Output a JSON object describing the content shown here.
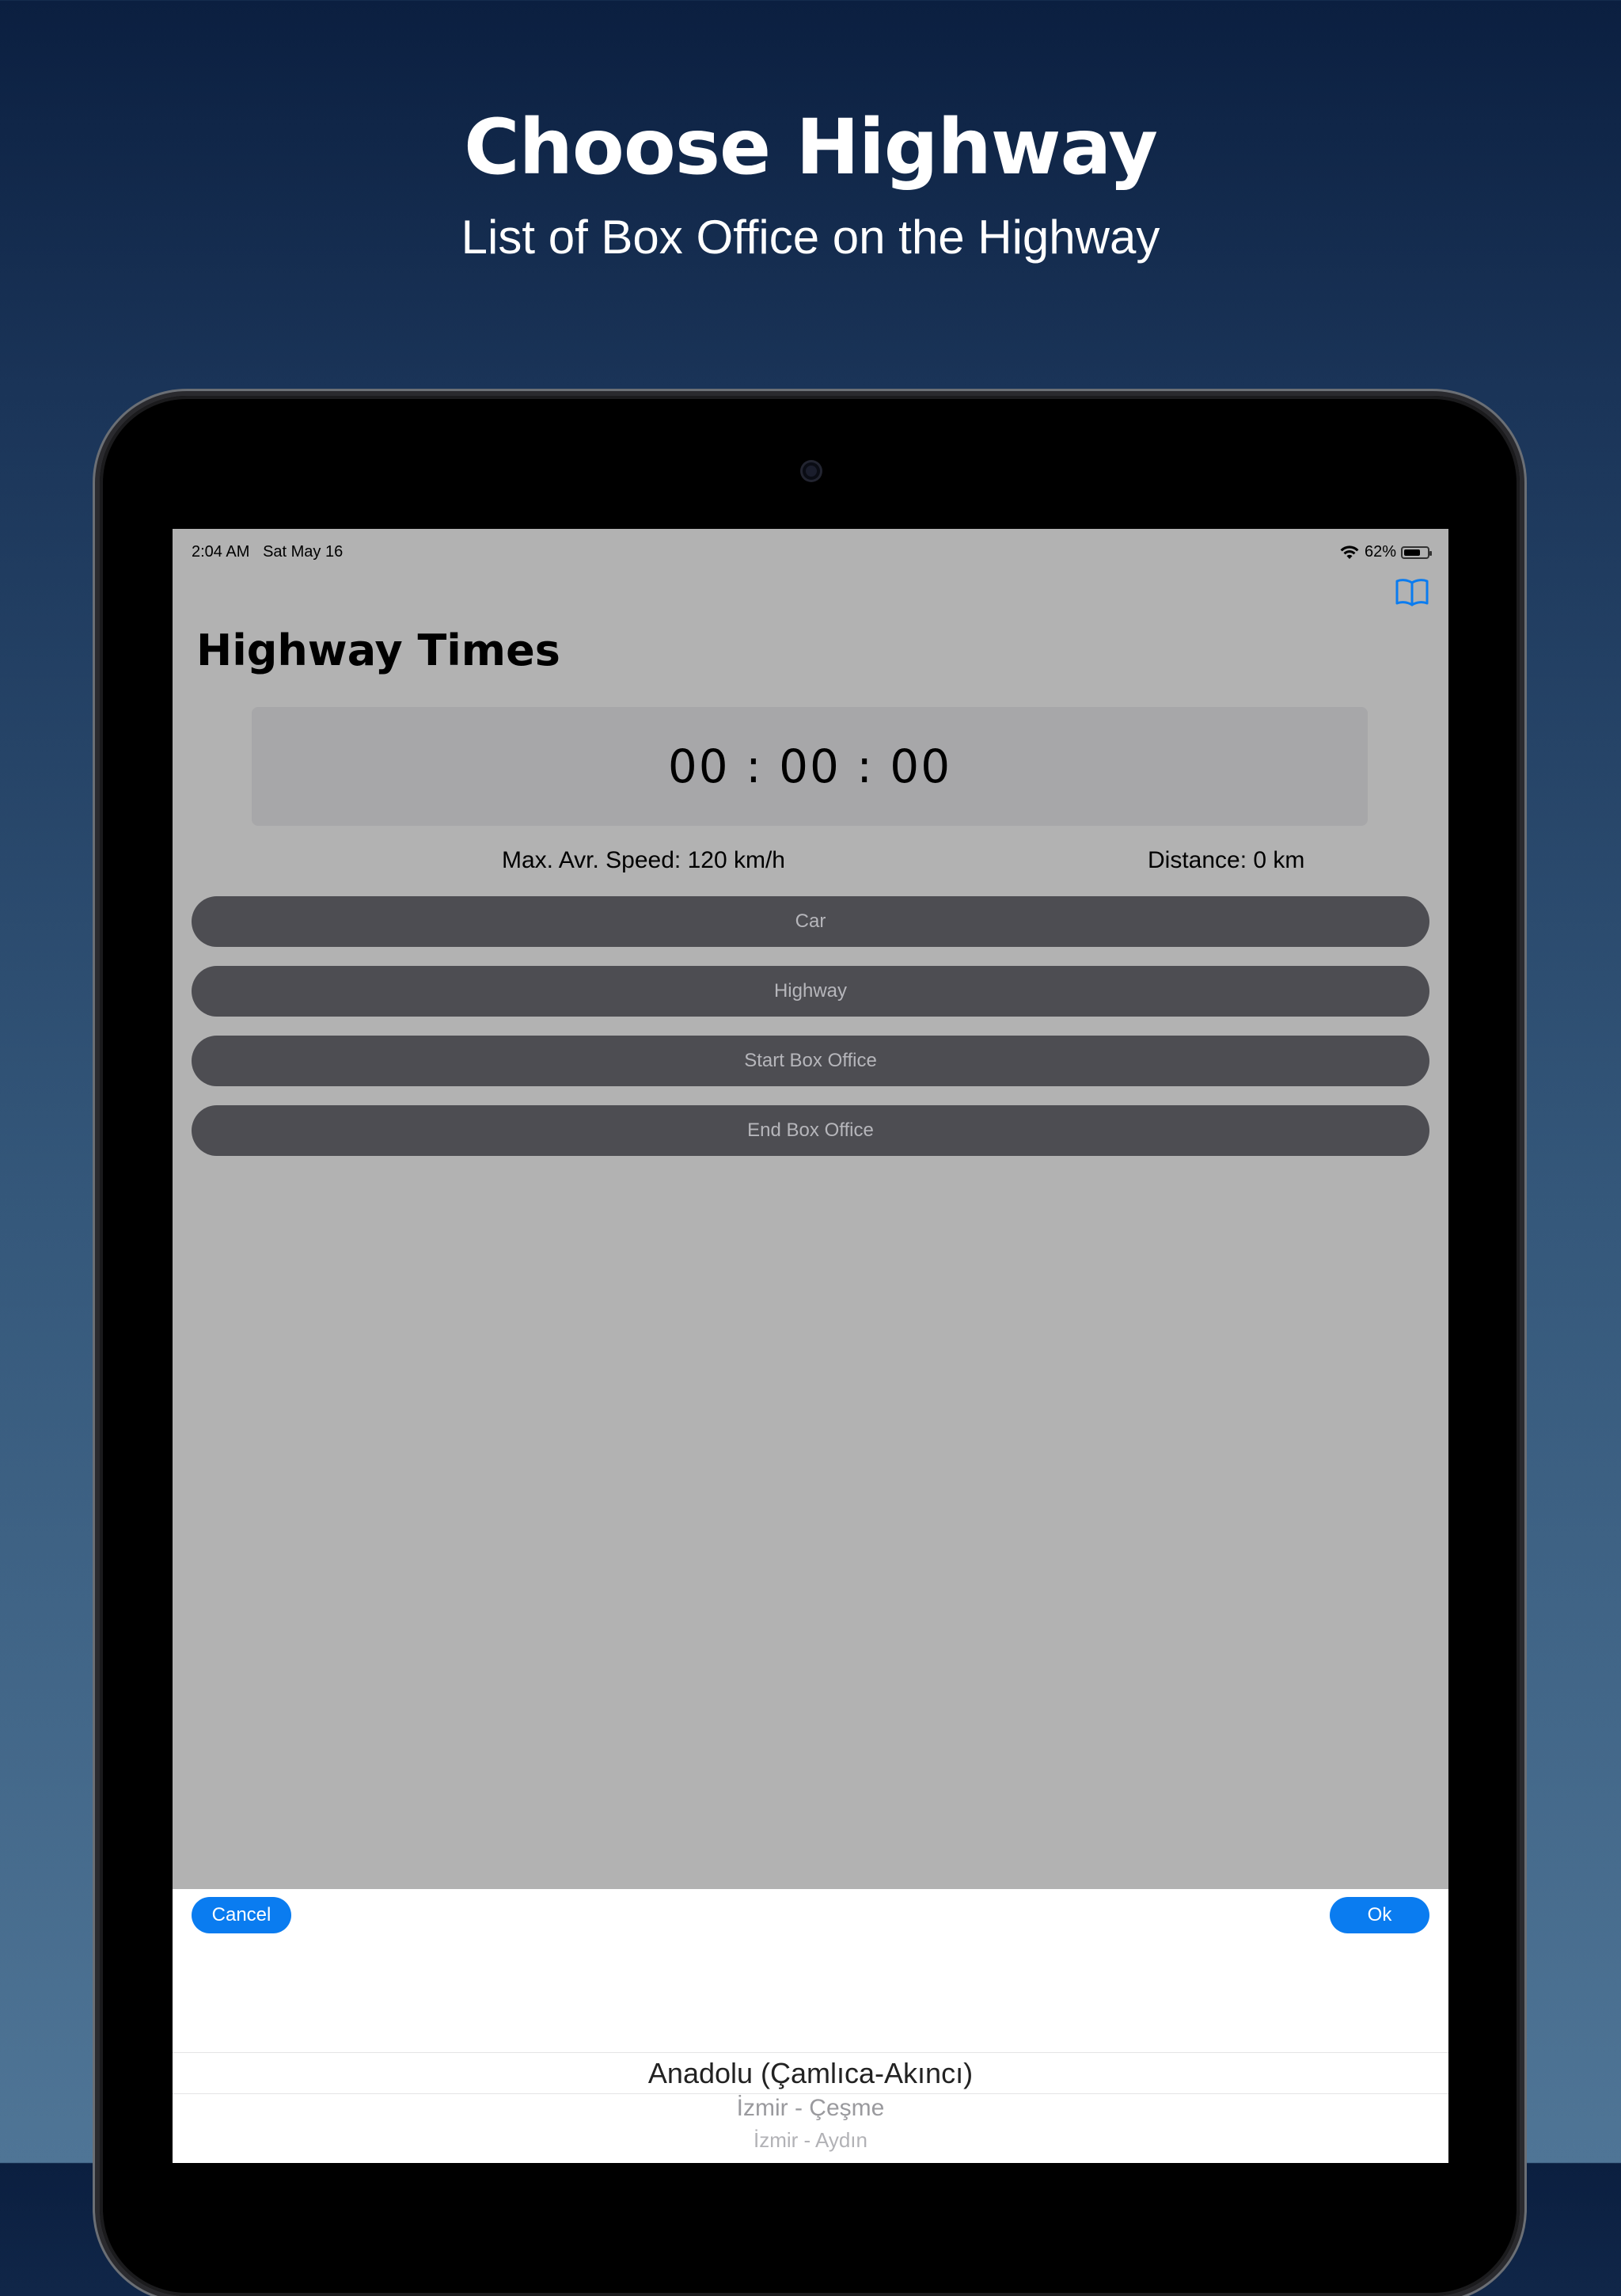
{
  "promo": {
    "headline": "Choose Highway",
    "subheadline": "List of Box Office on the Highway"
  },
  "status_bar": {
    "time": "2:04 AM",
    "date": "Sat May 16",
    "battery": "62%",
    "battery_level": 0.62
  },
  "app": {
    "title": "Highway Times",
    "timer": "00 : 00 : 00",
    "max_speed": "Max. Avr. Speed: 120 km/h",
    "distance": "Distance: 0 km",
    "buttons": {
      "car": "Car",
      "highway": "Highway",
      "start_box_office": "Start Box Office",
      "end_box_office": "End Box Office"
    }
  },
  "picker": {
    "cancel": "Cancel",
    "ok": "Ok",
    "options": [
      "Anadolu (Çamlıca-Akıncı)",
      "İzmir - Çeşme",
      "İzmir - Aydın"
    ],
    "selected_index": 0
  },
  "colors": {
    "accent": "#0a7cf0",
    "button_bg": "#4d4d52",
    "screen_bg": "#b2b2b2"
  }
}
